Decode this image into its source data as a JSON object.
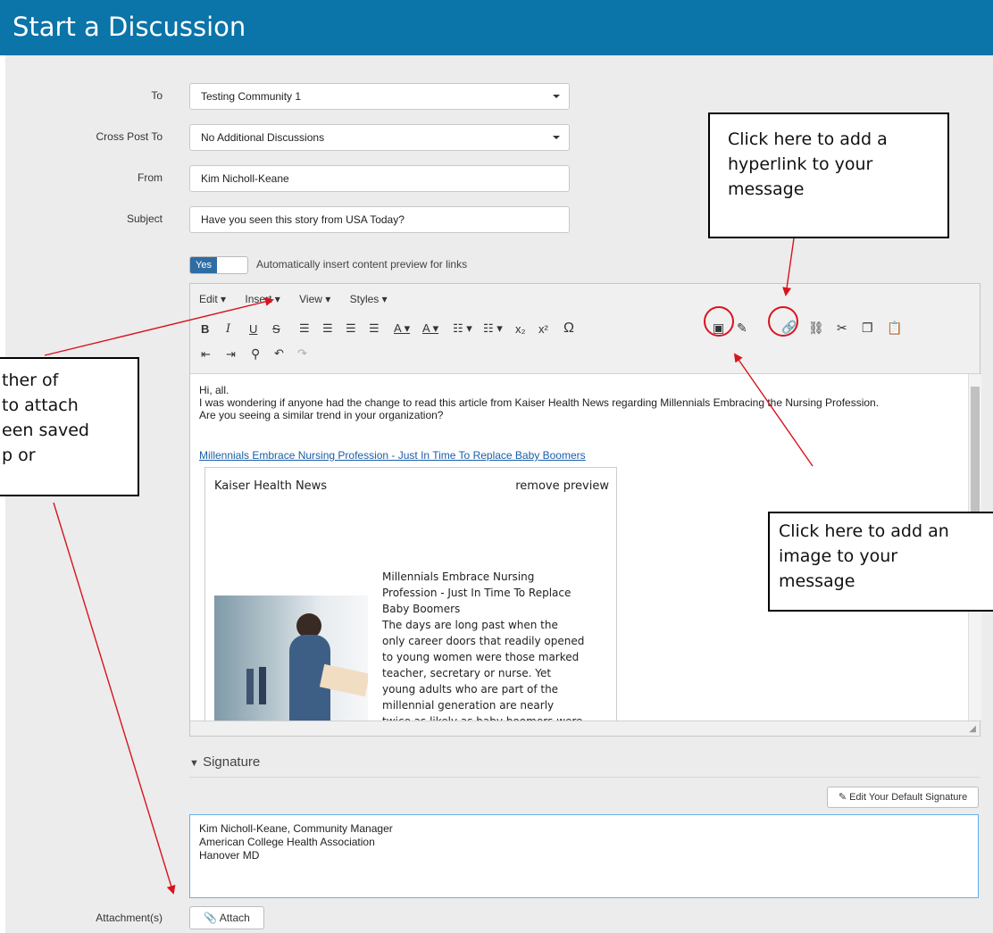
{
  "header": {
    "title": "Start a Discussion"
  },
  "form": {
    "to_label": "To",
    "to_value": "Testing Community 1",
    "crosspost_label": "Cross Post To",
    "crosspost_value": "No Additional Discussions",
    "from_label": "From",
    "from_value": "Kim Nicholl-Keane",
    "subject_label": "Subject",
    "subject_value": "Have you seen this story from USA Today?",
    "toggle_value": "Yes",
    "toggle_label": "Automatically insert content preview for links"
  },
  "editor": {
    "menu": [
      "Edit ▾",
      "Insert ▾",
      "View ▾",
      "Styles ▾"
    ],
    "line1": "Hi, all.",
    "line2": "I was wondering if anyone had the change to read this article from Kaiser Health News regarding Millennials Embracing the Nursing Profession.",
    "line3": "Are you seeing a similar trend in your organization?",
    "link_text": "Millennials Embrace Nursing Profession - Just In Time To Replace Baby Boomers",
    "preview": {
      "source": "Kaiser Health News",
      "remove": "remove preview",
      "headline": [
        "Millennials Embrace Nursing",
        "Profession - Just In Time To Replace",
        "Baby Boomers"
      ],
      "body": [
        "The days are long past when the",
        "only career doors that readily opened",
        "to young women were those marked",
        "teacher, secretary or nurse. Yet",
        "young adults who are part of the",
        "millennial generation are nearly",
        "twice as likely as baby boomers were"
      ]
    }
  },
  "signature": {
    "heading": "Signature",
    "edit_button": "Edit Your Default Signature",
    "lines": [
      "Kim Nicholl-Keane, Community Manager",
      "American College Health Association",
      "Hanover MD"
    ]
  },
  "attachments": {
    "label": "Attachment(s)",
    "button": "Attach"
  },
  "callouts": {
    "hyperlink": [
      "Click here to add a",
      "hyperlink to your",
      "message"
    ],
    "image": [
      "Click here to add an",
      "image to your",
      "message"
    ],
    "attach": [
      "ther of",
      "to attach",
      "een saved",
      "p or"
    ]
  },
  "colors": {
    "header": "#0b74a8",
    "annotation": "#d8141f",
    "link": "#1a5ea8",
    "toggle": "#2e6da4"
  }
}
